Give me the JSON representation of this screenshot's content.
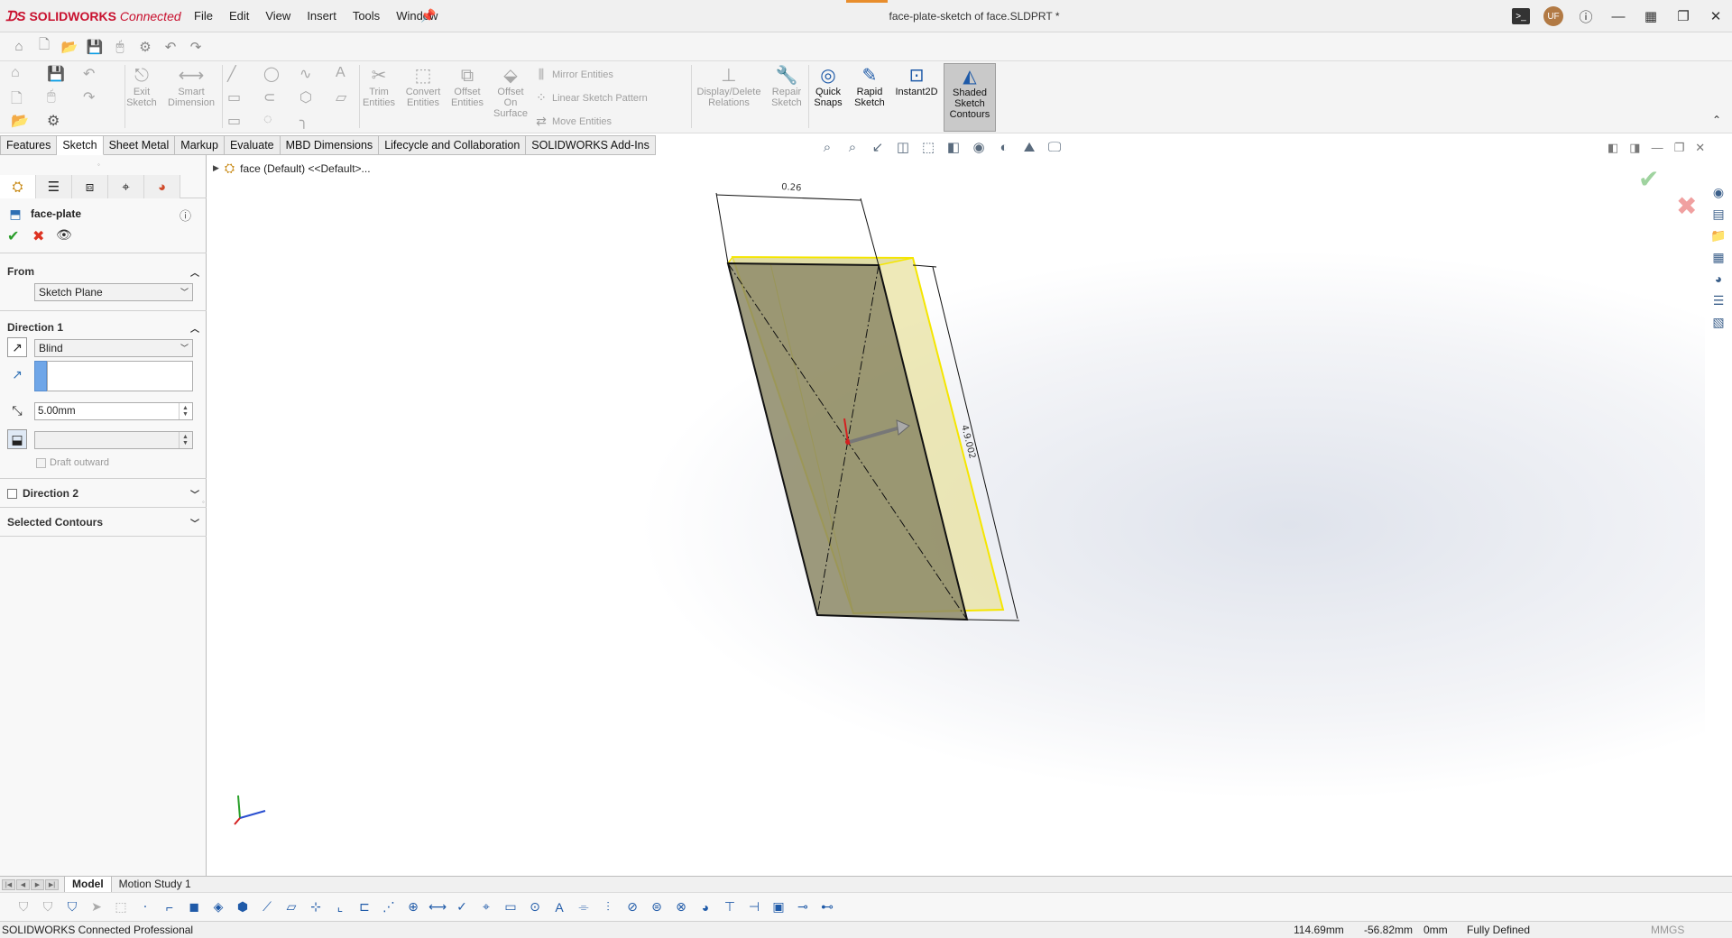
{
  "app": {
    "brand_bold": "SOLIDWORKS",
    "brand_rest": "Connected",
    "doc_title": "face-plate-sketch of face.SLDPRT *",
    "avatar": "UF",
    "accent": "#c8102e"
  },
  "menu": [
    "File",
    "Edit",
    "View",
    "Insert",
    "Tools",
    "Window"
  ],
  "command_manager": {
    "exit_sketch": "Exit Sketch",
    "smart_dimension": "Smart Dimension",
    "trim_entities": "Trim Entities",
    "convert_entities": "Convert Entities",
    "offset_entities": "Offset Entities",
    "offset_on_surface": "Offset On Surface",
    "mirror_entities": "Mirror Entities",
    "linear_sketch_pattern": "Linear Sketch Pattern",
    "move_entities": "Move Entities",
    "display_delete_relations": "Display/Delete Relations",
    "repair_sketch": "Repair Sketch",
    "quick_snaps": "Quick Snaps",
    "rapid_sketch": "Rapid Sketch",
    "instant2d": "Instant2D",
    "shaded_sketch_contours": "Shaded Sketch Contours"
  },
  "tabs": [
    "Features",
    "Sketch",
    "Sheet Metal",
    "Markup",
    "Evaluate",
    "MBD Dimensions",
    "Lifecycle and Collaboration",
    "SOLIDWORKS Add-Ins"
  ],
  "active_tab": "Sketch",
  "property_manager": {
    "title": "face-plate",
    "from_label": "From",
    "from_value": "Sketch Plane",
    "direction1_label": "Direction 1",
    "end_condition": "Blind",
    "depth": "5.00mm",
    "draft_outward": "Draft outward",
    "direction2_label": "Direction 2",
    "selected_contours_label": "Selected Contours"
  },
  "tree": {
    "root": "face (Default) <<Default>..."
  },
  "viewport": {
    "dim_top": "0.26",
    "dim_side": "4.9.002"
  },
  "bottom_tabs": [
    "Model",
    "Motion Study 1"
  ],
  "status": {
    "product": "SOLIDWORKS Connected Professional",
    "x": "114.69mm",
    "y": "-56.82mm",
    "z": "0mm",
    "state": "Fully Defined",
    "units": "MMGS"
  }
}
